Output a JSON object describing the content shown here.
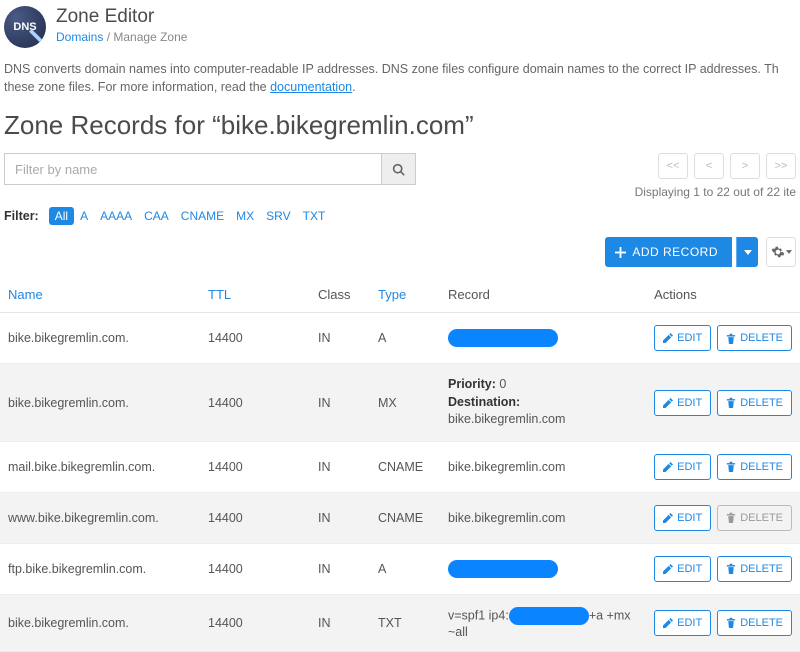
{
  "header": {
    "logo_text": "DNS",
    "title": "Zone Editor",
    "breadcrumb_link": "Domains",
    "breadcrumb_current": "Manage Zone"
  },
  "description": {
    "text_before": "DNS converts domain names into computer-readable IP addresses. DNS zone files configure domain names to the correct IP addresses. Th these zone files. For more information, read the ",
    "link_text": "documentation",
    "text_after": "."
  },
  "zone_title": "Zone Records for “bike.bikegremlin.com”",
  "filter": {
    "placeholder": "Filter by name",
    "label": "Filter:",
    "tags": [
      "All",
      "A",
      "AAAA",
      "CAA",
      "CNAME",
      "MX",
      "SRV",
      "TXT"
    ],
    "active": "All"
  },
  "pager": {
    "first": "<<",
    "prev": "<",
    "next": ">",
    "last": ">>",
    "status": "Displaying 1 to 22 out of 22 ite"
  },
  "toolbar": {
    "add_label": "ADD RECORD"
  },
  "table": {
    "headers": {
      "name": "Name",
      "ttl": "TTL",
      "class": "Class",
      "type": "Type",
      "record": "Record",
      "actions": "Actions"
    },
    "edit_label": "EDIT",
    "delete_label": "DELETE",
    "rows": [
      {
        "name": "bike.bikegremlin.com.",
        "ttl": "14400",
        "class": "IN",
        "type": "A",
        "record_kind": "redacted",
        "alt": false,
        "del_muted": false
      },
      {
        "name": "bike.bikegremlin.com.",
        "ttl": "14400",
        "class": "IN",
        "type": "MX",
        "record_kind": "mx",
        "priority_label": "Priority:",
        "priority_value": "0",
        "dest_label": "Destination:",
        "dest_value": "bike.bikegremlin.com",
        "alt": true,
        "del_muted": false
      },
      {
        "name": "mail.bike.bikegremlin.com.",
        "ttl": "14400",
        "class": "IN",
        "type": "CNAME",
        "record_kind": "text",
        "record": "bike.bikegremlin.com",
        "alt": false,
        "del_muted": false
      },
      {
        "name": "www.bike.bikegremlin.com.",
        "ttl": "14400",
        "class": "IN",
        "type": "CNAME",
        "record_kind": "text",
        "record": "bike.bikegremlin.com",
        "alt": true,
        "del_muted": true
      },
      {
        "name": "ftp.bike.bikegremlin.com.",
        "ttl": "14400",
        "class": "IN",
        "type": "A",
        "record_kind": "redacted",
        "alt": false,
        "del_muted": false
      },
      {
        "name": "bike.bikegremlin.com.",
        "ttl": "14400",
        "class": "IN",
        "type": "TXT",
        "record_kind": "spf",
        "record_pre": "v=spf1 ip4:",
        "record_post": "+a +mx ~all",
        "alt": true,
        "del_muted": false
      }
    ]
  }
}
